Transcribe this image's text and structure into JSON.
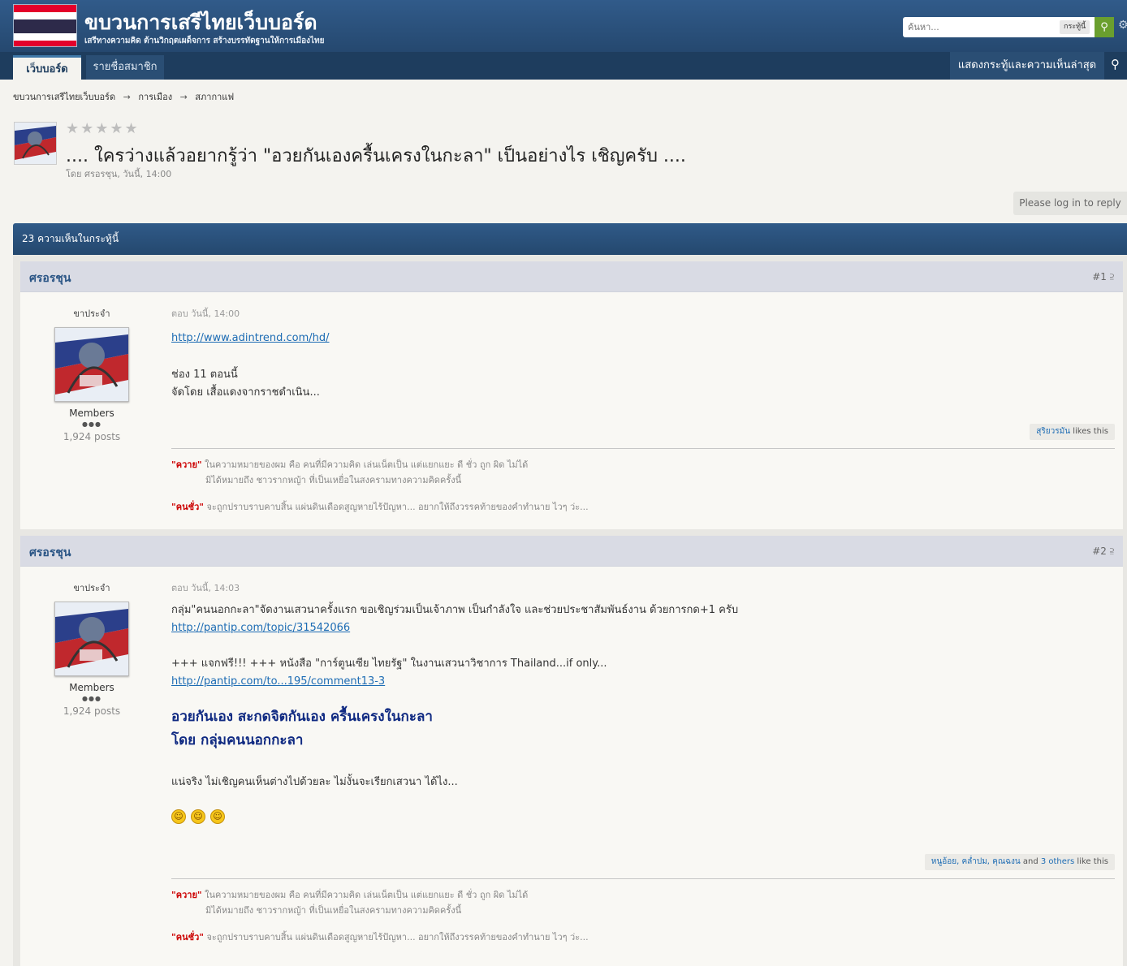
{
  "header": {
    "site_title": "ขบวนการเสรีไทยเว็บบอร์ด",
    "tagline": "เสรีทางความคิด ต้านวิกฤตเผด็จการ สร้างบรรทัดฐานให้การเมืองไทย",
    "search_placeholder": "ค้นหา...",
    "search_scope": "กระทู้นี้",
    "search_icon": "search-icon",
    "settings_icon": "gear-icon"
  },
  "nav": {
    "tab_forums": "เว็บบอร์ด",
    "tab_members": "รายชื่อสมาชิก",
    "latest": "แสดงกระทู้และความเห็นล่าสุด"
  },
  "breadcrumb": {
    "items": [
      "ขบวนการเสรีไทยเว็บบอร์ด",
      "การเมือง",
      "สภากาแฟ"
    ],
    "sep": "→"
  },
  "topic": {
    "stars": "★★★★★",
    "title": ".... ใครว่างแล้วอยากรู้ว่า \"อวยกันเองครื้นเครงในกะลา\" เป็นอย่างไร เชิญครับ ....",
    "meta": "โดย ศรอรชุน, วันนี้, 14:00",
    "reply_btn": "Please log in to reply",
    "rating_value": 0
  },
  "comments_bar": "23 ความเห็นในกระทู้นี้",
  "posts": [
    {
      "author": "ศรอรชุน",
      "num": "#1",
      "rank": "ขาประจำ",
      "group": "Members",
      "pips": "●●●",
      "count": "1,924 posts",
      "date": "ตอบ วันนี้, 14:00",
      "link1": "http://www.adintrend.com/hd/",
      "line1": "ช่อง 11 ตอนนี้",
      "line2": "จัดโดย เสื้อแดงจากราชดำเนิน...",
      "likes_name": "สุริยวรมัน",
      "likes_suffix": " likes this",
      "sig1_label": "\"ควาย\"",
      "sig1_text": " ในความหมายของผม คือ คนที่มีความคิด เล่นเน็ตเป็น แต่แยกแยะ ดี ชั่ว ถูก ผิด ไม่ได้",
      "sig1_line2": "มิได้หมายถึง ชาวรากหญ้า ที่เป็นเหยื่อในสงครามทางความคิดครั้งนี้",
      "sig2_label": "\"คนชั่ว\"",
      "sig2_text": " จะถูกปราบราบคาบสิ้น แผ่นดินเดือดสูญหายไร้ปัญหา... อยากให้ถึงวรรคท้ายของคำทำนาย ไวๆ ว่ะ..."
    },
    {
      "author": "ศรอรชุน",
      "num": "#2",
      "rank": "ขาประจำ",
      "group": "Members",
      "pips": "●●●",
      "count": "1,924 posts",
      "date": "ตอบ วันนี้, 14:03",
      "line1": "กลุ่ม\"คนนอกกะลา\"จัดงานเสวนาครั้งแรก ขอเชิญร่วมเป็นเจ้าภาพ เป็นกำลังใจ และช่วยประชาสัมพันธ์งาน ด้วยการกด+1 ครับ",
      "link1": "http://pantip.com/topic/31542066",
      "line2": "+++ แจกฟรี!!! +++ หนังสือ \"การ์ตูนเซีย ไทยรัฐ\" ในงานเสวนาวิชาการ Thailand...if only...",
      "link2": "http://pantip.com/to...195/comment13-3",
      "big1": "อวยกันเอง สะกดจิตกันเอง ครื้นเครงในกะลา",
      "big2": "โดย กลุ่มคนนอกกะลา",
      "line3": "แน่จริง ไม่เชิญคนเห็นต่างไปด้วยละ ไม่งั้นจะเรียกเสวนา ได้ไง...",
      "likes_names": "หนูอ้อย, คล่ำปม, คุณฉงน",
      "likes_and": " and ",
      "likes_others": "3 others",
      "likes_suffix": " like this",
      "sig1_label": "\"ควาย\"",
      "sig1_text": " ในความหมายของผม คือ คนที่มีความคิด เล่นเน็ตเป็น แต่แยกแยะ ดี ชั่ว ถูก ผิด ไม่ได้",
      "sig1_line2": "มิได้หมายถึง ชาวรากหญ้า ที่เป็นเหยื่อในสงครามทางความคิดครั้งนี้",
      "sig2_label": "\"คนชั่ว\"",
      "sig2_text": " จะถูกปราบราบคาบสิ้น แผ่นดินเดือดสูญหายไร้ปัญหา... อยากให้ถึงวรรคท้ายของคำทำนาย ไวๆ ว่ะ..."
    }
  ],
  "colors": {
    "header": "#2b5281",
    "nav": "#1e3d5e",
    "accent_green": "#6a9f2e",
    "link": "#1d6cb4",
    "sig_red": "#cc0000"
  }
}
